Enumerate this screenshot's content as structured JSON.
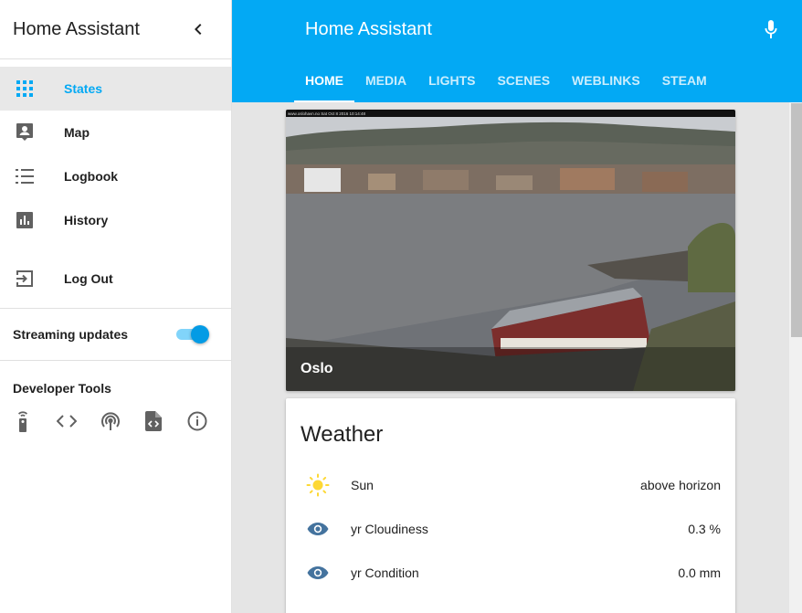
{
  "sidebar": {
    "title": "Home Assistant",
    "items": [
      {
        "label": "States",
        "icon": "grid-icon",
        "active": true
      },
      {
        "label": "Map",
        "icon": "map-account-icon"
      },
      {
        "label": "Logbook",
        "icon": "list-icon"
      },
      {
        "label": "History",
        "icon": "bar-chart-icon"
      },
      {
        "label": "Log Out",
        "icon": "exit-icon"
      }
    ],
    "streaming_label": "Streaming updates",
    "streaming_on": true,
    "dev_tools_title": "Developer Tools",
    "dev_tools": [
      "remote-icon",
      "code-icon",
      "broadcast-icon",
      "file-code-icon",
      "info-icon"
    ]
  },
  "header": {
    "title": "Home Assistant",
    "tabs": [
      "HOME",
      "MEDIA",
      "LIGHTS",
      "SCENES",
      "WEBLINKS",
      "STEAM"
    ],
    "active_tab": "HOME"
  },
  "camera": {
    "caption": "Oslo",
    "overlay_text": "www.oslohavn.no Sat Oct 8 2016 10:14:48"
  },
  "weather": {
    "title": "Weather",
    "rows": [
      {
        "name": "Sun",
        "value": "above horizon",
        "icon": "sun-icon"
      },
      {
        "name": "yr Cloudiness",
        "value": "0.3 %",
        "icon": "eye-icon"
      },
      {
        "name": "yr Condition",
        "value": "0.0 mm",
        "icon": "eye-icon"
      }
    ]
  },
  "colors": {
    "accent": "#03a9f4",
    "sun": "#fdd835",
    "eye": "#44739e"
  }
}
